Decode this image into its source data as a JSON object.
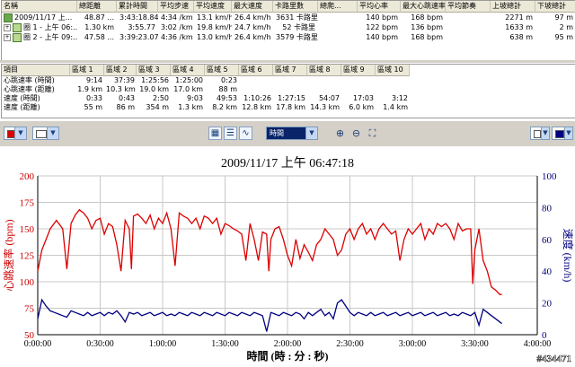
{
  "lap_table": {
    "columns": [
      "名稱",
      "總距離",
      "累計時間",
      "平均步速",
      "平均速度",
      "最大速度",
      "卡路里數",
      "總爬...",
      "平均心率",
      "最大心跳速率",
      "平均節奏",
      "上坡總計",
      "下坡總計"
    ],
    "rows": [
      {
        "name": "2009/11/17 上...",
        "expand": "",
        "icon": "sum",
        "cells": [
          "48.87 ...",
          "3:43:18.84",
          "4:34 /km",
          "13.1 km/h",
          "26.4 km/h",
          "3631 卡路里",
          "",
          "140 bpm",
          "168 bpm",
          "",
          "2271 m",
          "97 m"
        ]
      },
      {
        "name": "圈 1 - 上午 06:...",
        "expand": "+",
        "icon": "lap",
        "cells": [
          "1.30 km",
          "3:55.77",
          "3:02 /km",
          "19.8 km/h",
          "24.7 km/h",
          "52 卡路里",
          "",
          "122 bpm",
          "136 bpm",
          "",
          "1633 m",
          "2 m"
        ]
      },
      {
        "name": "圈 2 - 上午 09:...",
        "expand": "+",
        "icon": "lap",
        "cells": [
          "47.58 ...",
          "3:39:23.07",
          "4:36 /km",
          "13.0 km/h",
          "26.4 km/h",
          "3579 卡路里",
          "",
          "140 bpm",
          "168 bpm",
          "",
          "638 m",
          "95 m"
        ]
      }
    ]
  },
  "zone_table": {
    "columns": [
      "項目",
      "區域 1",
      "區域 2",
      "區域 3",
      "區域 4",
      "區域 5",
      "區域 6",
      "區域 7",
      "區域 8",
      "區域 9",
      "區域 10"
    ],
    "rows": [
      {
        "label": "心跳速率 (時間)",
        "cells": [
          "9:14",
          "37:39",
          "1:25:56",
          "1:25:00",
          "0:23",
          "",
          "",
          "",
          "",
          ""
        ]
      },
      {
        "label": "心跳速率 (距離)",
        "cells": [
          "1.9 km",
          "10.3 km",
          "19.0 km",
          "17.0 km",
          "88 m",
          "",
          "",
          "",
          "",
          ""
        ]
      },
      {
        "label": "速度 (時間)",
        "cells": [
          "0:33",
          "0:43",
          "2:50",
          "9:03",
          "49:53",
          "1:10:26",
          "1:27:15",
          "54:07",
          "17:03",
          "3:12"
        ]
      },
      {
        "label": "速度 (距離)",
        "cells": [
          "55 m",
          "86 m",
          "354 m",
          "1.3 km",
          "8.2 km",
          "12.8 km",
          "17.8 km",
          "14.3 km",
          "6.0 km",
          "1.4 km"
        ]
      }
    ]
  },
  "toolbar": {
    "left_color": "#dd0000",
    "second_color": "#ffffff",
    "xaxis_select": "時間",
    "right_color1": "#ffffff",
    "right_color2": "#000080",
    "icons": [
      "grid-view-icon",
      "table-view-icon",
      "chart-view-icon",
      "zoom-in-icon",
      "zoom-out-icon",
      "fit-icon"
    ]
  },
  "chart_data": {
    "type": "line",
    "title": "2009/11/17 上午 06:47:18",
    "xlabel": "時間 (時 : 分 : 秒)",
    "ylabel_left": "心跳速率 (bpm)",
    "ylabel_right": "速度 (km/h)",
    "x_ticks": [
      "0:00:00",
      "0:30:00",
      "1:00:00",
      "1:30:00",
      "2:00:00",
      "2:30:00",
      "3:00:00",
      "3:30:00",
      "4:00:00"
    ],
    "xlim": [
      0,
      240
    ],
    "ylim_left": [
      50,
      200
    ],
    "ylim_right": [
      0,
      100
    ],
    "y_ticks_left": [
      50,
      75,
      100,
      125,
      150,
      175,
      200
    ],
    "y_ticks_right": [
      0,
      20,
      40,
      60,
      80,
      100
    ],
    "grid": true,
    "series": [
      {
        "name": "",
        "axis": "left",
        "color": "#dd0000",
        "x": [
          0,
          2,
          4,
          6,
          9,
          12,
          14,
          16,
          18,
          20,
          22,
          24,
          26,
          28,
          30,
          32,
          34,
          36,
          38,
          40,
          42,
          44,
          45,
          46,
          48,
          50,
          52,
          54,
          56,
          58,
          60,
          62,
          64,
          66,
          68,
          70,
          72,
          74,
          76,
          78,
          80,
          82,
          84,
          86,
          88,
          90,
          92,
          94,
          96,
          98,
          100,
          102,
          104,
          106,
          108,
          110,
          111,
          112,
          114,
          116,
          118,
          120,
          122,
          124,
          126,
          128,
          130,
          132,
          134,
          136,
          138,
          140,
          142,
          144,
          146,
          148,
          150,
          152,
          154,
          156,
          158,
          160,
          162,
          164,
          166,
          168,
          170,
          172,
          174,
          176,
          178,
          180,
          182,
          184,
          186,
          188,
          190,
          192,
          194,
          196,
          198,
          200,
          202,
          204,
          206,
          208,
          209,
          210,
          212,
          214,
          216,
          218,
          220,
          222,
          223
        ],
        "y": [
          110,
          130,
          140,
          150,
          158,
          150,
          112,
          155,
          163,
          168,
          165,
          160,
          150,
          158,
          160,
          145,
          155,
          152,
          135,
          110,
          158,
          150,
          112,
          162,
          164,
          160,
          155,
          163,
          150,
          160,
          155,
          165,
          150,
          115,
          165,
          162,
          160,
          155,
          160,
          150,
          162,
          160,
          155,
          160,
          145,
          155,
          153,
          150,
          148,
          145,
          120,
          155,
          140,
          120,
          147,
          145,
          110,
          140,
          150,
          152,
          140,
          125,
          115,
          140,
          122,
          135,
          128,
          120,
          135,
          140,
          150,
          145,
          140,
          125,
          130,
          145,
          150,
          140,
          150,
          155,
          145,
          150,
          140,
          150,
          155,
          150,
          145,
          148,
          120,
          140,
          150,
          145,
          150,
          155,
          140,
          150,
          145,
          155,
          152,
          155,
          150,
          140,
          155,
          148,
          150,
          150,
          98,
          130,
          150,
          120,
          110,
          95,
          92,
          88,
          88
        ]
      },
      {
        "name": "",
        "axis": "right",
        "color": "#000080",
        "x": [
          0,
          2,
          4,
          6,
          8,
          10,
          12,
          14,
          16,
          18,
          20,
          22,
          24,
          26,
          28,
          30,
          32,
          34,
          36,
          38,
          40,
          42,
          44,
          46,
          48,
          50,
          52,
          54,
          56,
          58,
          60,
          62,
          64,
          66,
          68,
          70,
          72,
          74,
          76,
          78,
          80,
          82,
          84,
          86,
          88,
          90,
          92,
          94,
          96,
          98,
          100,
          102,
          104,
          106,
          108,
          110,
          112,
          114,
          116,
          118,
          120,
          122,
          124,
          126,
          128,
          130,
          132,
          134,
          136,
          138,
          140,
          142,
          144,
          146,
          148,
          150,
          152,
          154,
          156,
          158,
          160,
          162,
          164,
          166,
          168,
          170,
          172,
          174,
          176,
          178,
          180,
          182,
          184,
          186,
          188,
          190,
          192,
          194,
          196,
          198,
          200,
          202,
          204,
          206,
          208,
          210,
          212,
          214,
          216,
          218,
          220,
          222,
          223
        ],
        "y": [
          10,
          22,
          18,
          15,
          14,
          13,
          12,
          11,
          15,
          14,
          13,
          12,
          14,
          12,
          13,
          14,
          12,
          14,
          13,
          15,
          12,
          8,
          14,
          13,
          14,
          12,
          13,
          14,
          12,
          13,
          14,
          12,
          13,
          12,
          14,
          13,
          12,
          14,
          13,
          12,
          14,
          13,
          12,
          14,
          13,
          12,
          14,
          13,
          12,
          14,
          13,
          12,
          14,
          13,
          12,
          2,
          14,
          13,
          12,
          14,
          13,
          12,
          14,
          13,
          10,
          14,
          12,
          14,
          16,
          12,
          14,
          10,
          20,
          22,
          18,
          14,
          12,
          14,
          13,
          12,
          14,
          12,
          13,
          14,
          12,
          13,
          14,
          12,
          13,
          14,
          12,
          13,
          14,
          12,
          13,
          14,
          12,
          13,
          14,
          12,
          13,
          12,
          14,
          13,
          12,
          14,
          6,
          16,
          14,
          12,
          10,
          8,
          7
        ]
      }
    ]
  },
  "watermark": "#434471"
}
